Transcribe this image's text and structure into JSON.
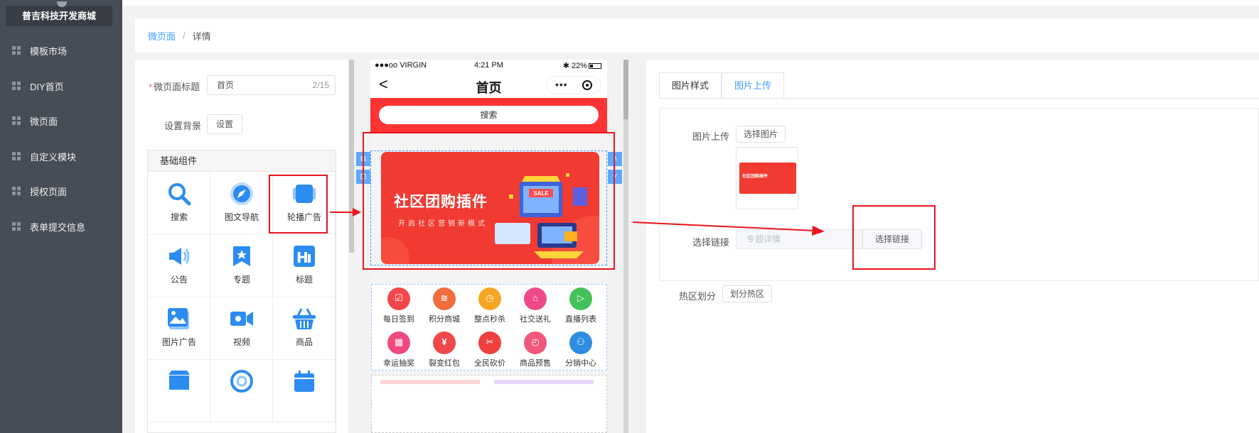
{
  "sidebar": {
    "brand": "普吉科技开发商城",
    "items": [
      {
        "label": "模板市场"
      },
      {
        "label": "DIY首页"
      },
      {
        "label": "微页面"
      },
      {
        "label": "自定义模块"
      },
      {
        "label": "授权页面"
      },
      {
        "label": "表单提交信息"
      }
    ]
  },
  "breadcrumb": {
    "parent": "微页面",
    "separator": "/",
    "current": "详情"
  },
  "settings": {
    "title_label": "微页面标题",
    "title_required_mark": "*",
    "title_value": "首页",
    "title_count": "2/15",
    "background_label": "设置背景",
    "background_button": "设置"
  },
  "components": {
    "header": "基础组件",
    "items": [
      {
        "label": "搜索",
        "icon": "search-icon"
      },
      {
        "label": "图文导航",
        "icon": "navigation-icon"
      },
      {
        "label": "轮播广告",
        "icon": "carousel-icon"
      },
      {
        "label": "公告",
        "icon": "megaphone-icon"
      },
      {
        "label": "专题",
        "icon": "topic-icon"
      },
      {
        "label": "标题",
        "icon": "heading-icon"
      },
      {
        "label": "图片广告",
        "icon": "image-icon"
      },
      {
        "label": "视频",
        "icon": "video-icon"
      },
      {
        "label": "商品",
        "icon": "basket-icon"
      }
    ]
  },
  "phone": {
    "carrier": "●●●oo VIRGIN",
    "time": "4:21 PM",
    "battery": "22%",
    "page_title": "首页",
    "back_glyph": "<",
    "search_placeholder": "搜索",
    "banner_title": "社区团购插件",
    "banner_subtitle": "开启社区营销新模式",
    "banner_sign": "SALE",
    "nav_items": [
      {
        "label": "每日签到",
        "color": "#f2474a"
      },
      {
        "label": "积分商城",
        "color": "#f36d3d"
      },
      {
        "label": "整点秒杀",
        "color": "#f6a623"
      },
      {
        "label": "社交送礼",
        "color": "#ee4a8a"
      },
      {
        "label": "直播列表",
        "color": "#44c25a"
      },
      {
        "label": "幸运抽奖",
        "color": "#ee4a7e"
      },
      {
        "label": "裂变红包",
        "color": "#f04848"
      },
      {
        "label": "全民砍价",
        "color": "#f03f3f"
      },
      {
        "label": "商品预售",
        "color": "#f0577a"
      },
      {
        "label": "分销中心",
        "color": "#2d8ce0"
      }
    ],
    "nav_glyphs": [
      "☑",
      "≋",
      "◷",
      "⌂",
      "▷",
      "▦",
      "¥",
      "✂",
      "◴",
      "⚇"
    ]
  },
  "editor": {
    "tabs": [
      {
        "label": "图片样式",
        "active": false
      },
      {
        "label": "图片上传",
        "active": true
      }
    ],
    "upload_label": "图片上传",
    "upload_button": "选择图片",
    "thumb_text": "社区团购插件",
    "link_label": "选择链接",
    "link_placeholder": "专题详情",
    "link_button": "选择链接",
    "hotspot_label": "热区划分",
    "hotspot_button": "划分热区"
  },
  "colors": {
    "accent": "#409eff",
    "brand_red": "#f33",
    "annotation_red": "#e8151c"
  }
}
